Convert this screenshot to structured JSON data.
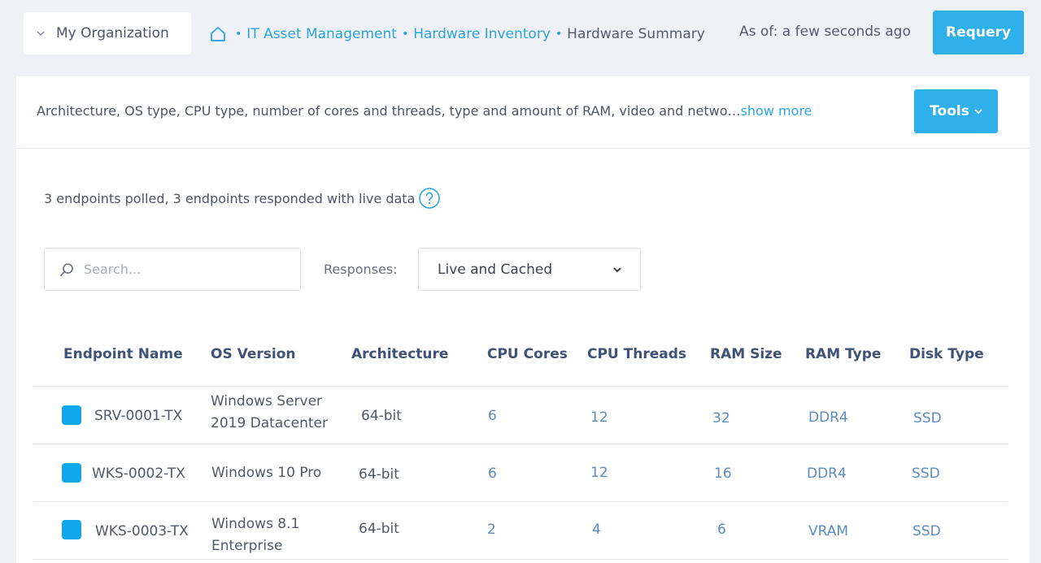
{
  "org": {
    "label": "My Organization"
  },
  "breadcrumb": {
    "items": [
      "IT Asset Management",
      "Hardware Inventory"
    ],
    "current": "Hardware Summary"
  },
  "asof": "As of: a few seconds ago",
  "requery_label": "Requery",
  "description": {
    "text": "Architecture, OS type, CPU type, number of cores and threads, type and amount of RAM, video and netwo…",
    "more": "show more"
  },
  "tools_label": "Tools",
  "polled_text": "3 endpoints polled, 3 endpoints responded with live data",
  "search": {
    "placeholder": "Search..."
  },
  "responses": {
    "label": "Responses:",
    "value": "Live and Cached"
  },
  "table": {
    "headers": [
      "Endpoint Name",
      "OS Version",
      "Architecture",
      "CPU Cores",
      "CPU Threads",
      "RAM Size",
      "RAM Type",
      "Disk Type"
    ],
    "rows": [
      {
        "name": "SRV-0001-TX",
        "os1": "Windows Server",
        "os2": "2019 Datacenter",
        "arch": "64-bit",
        "cores": "6",
        "threads": "12",
        "ram": "32",
        "ramtype": "DDR4",
        "disk": "SSD"
      },
      {
        "name": "WKS-0002-TX",
        "os1": "Windows 10 Pro",
        "os2": "",
        "arch": "64-bit",
        "cores": "6",
        "threads": "12",
        "ram": "16",
        "ramtype": "DDR4",
        "disk": "SSD"
      },
      {
        "name": "WKS-0003-TX",
        "os1": "Windows 8.1",
        "os2": "Enterprise",
        "arch": "64-bit",
        "cores": "2",
        "threads": "4",
        "ram": "6",
        "ramtype": "VRAM",
        "disk": "SSD"
      }
    ]
  },
  "colors": {
    "accent": "#2fb0ea",
    "link": "#2aa5de",
    "checkbox": "#0fa8ea"
  }
}
